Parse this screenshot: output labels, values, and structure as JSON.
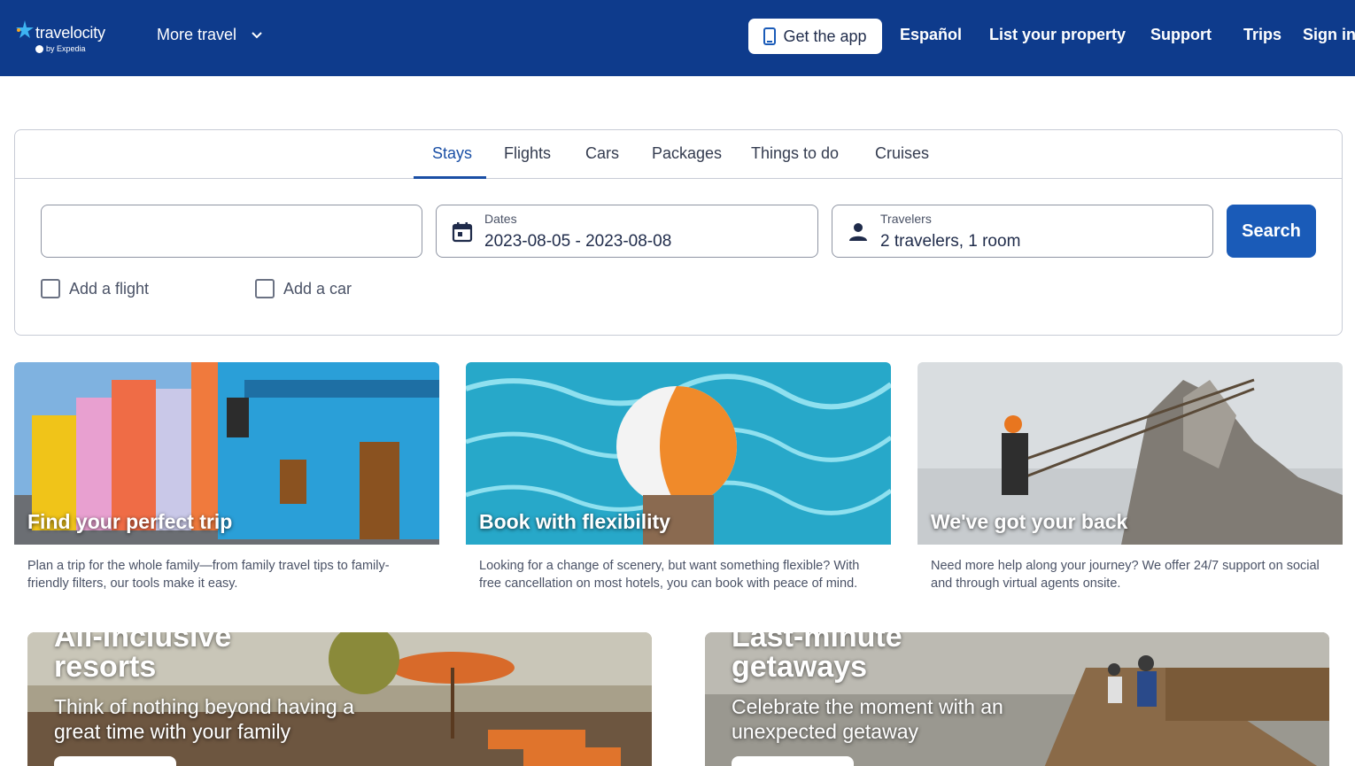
{
  "header": {
    "logo_text": "travelocity",
    "logo_sub": "by Expedia",
    "more_travel": "More travel",
    "get_app": "Get the app",
    "links": [
      "Español",
      "List your property",
      "Support",
      "Trips",
      "Sign in"
    ]
  },
  "search": {
    "tabs": [
      "Stays",
      "Flights",
      "Cars",
      "Packages",
      "Things to do",
      "Cruises"
    ],
    "active_tab": "Stays",
    "destination_value": "",
    "dates_label": "Dates",
    "dates_value": "2023-08-05 - 2023-08-08",
    "travelers_label": "Travelers",
    "travelers_value": "2 travelers, 1 room",
    "search_button": "Search",
    "add_flight": "Add a flight",
    "add_car": "Add a car"
  },
  "features": [
    {
      "title": "Find your perfect trip",
      "desc": "Plan a trip for the whole family—from family travel tips to family-friendly filters, our tools make it easy."
    },
    {
      "title": "Book with flexibility",
      "desc": "Looking for a change of scenery, but want something flexible? With free cancellation on most hotels, you can book with peace of mind."
    },
    {
      "title": "We've got your back",
      "desc": "Need more help along your journey? We offer 24/7 support on social and through virtual agents onsite."
    }
  ],
  "promos": [
    {
      "title_top": "All-inclusive",
      "title": "resorts",
      "subtitle": "Think of nothing beyond having a great time with your family"
    },
    {
      "title_top": "Last-minute",
      "title": "getaways",
      "subtitle": "Celebrate the moment with an unexpected getaway"
    }
  ],
  "colors": {
    "header_bg": "#0e3b8c",
    "accent": "#1a5bb8",
    "active_tab": "#1a4fa5"
  }
}
